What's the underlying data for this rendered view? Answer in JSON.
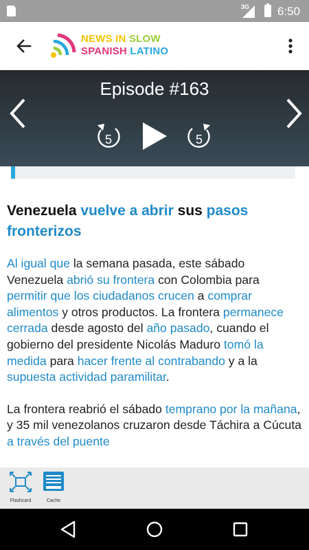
{
  "status_bar": {
    "network": "3G",
    "time": "6:50",
    "icons": [
      "sd-card-icon",
      "signal-icon",
      "battery-icon"
    ]
  },
  "app_bar": {
    "brand_line1_a": "NEWS IN",
    "brand_line1_b": "SLOW",
    "brand_line2_a": "SPANISH",
    "brand_line2_b": "LATINO",
    "icons": [
      "back-arrow-icon",
      "logo-icon",
      "overflow-menu-icon"
    ]
  },
  "player": {
    "episode_title": "Episode #163",
    "rewind_seconds": "5",
    "forward_seconds": "5",
    "progress_fraction": 0.015
  },
  "article": {
    "headline": [
      {
        "t": "Venezuela ",
        "k": false
      },
      {
        "t": "vuelve a abrir",
        "k": true
      },
      {
        "t": " sus ",
        "k": false
      },
      {
        "t": "pasos fronterizos",
        "k": true
      }
    ],
    "paragraphs": [
      [
        {
          "t": "Al igual que",
          "k": true
        },
        {
          "t": " la semana pasada, este sábado Venezuela ",
          "k": false
        },
        {
          "t": "abrió su frontera",
          "k": true
        },
        {
          "t": " con Colombia para ",
          "k": false
        },
        {
          "t": "permitir que los ciudadanos crucen",
          "k": true
        },
        {
          "t": " a ",
          "k": false
        },
        {
          "t": "comprar alimentos",
          "k": true
        },
        {
          "t": " y otros productos. La frontera ",
          "k": false
        },
        {
          "t": "permanece cerrada",
          "k": true
        },
        {
          "t": " desde agosto del ",
          "k": false
        },
        {
          "t": "año pasado",
          "k": true
        },
        {
          "t": ", cuando el gobierno del presidente Nicolás Maduro ",
          "k": false
        },
        {
          "t": "tomó la medida",
          "k": true
        },
        {
          "t": " para ",
          "k": false
        },
        {
          "t": "hacer frente al contrabando",
          "k": true
        },
        {
          "t": " y a la ",
          "k": false
        },
        {
          "t": "supuesta actividad paramilitar",
          "k": true
        },
        {
          "t": ".",
          "k": false
        }
      ],
      [
        {
          "t": "La frontera reabrió el sábado ",
          "k": false
        },
        {
          "t": "temprano por la mañana",
          "k": true
        },
        {
          "t": ", y 35 mil venezolanos cruzaron desde Táchira a Cúcuta ",
          "k": false
        },
        {
          "t": "a través del puente",
          "k": true
        }
      ]
    ]
  },
  "toolbar": {
    "flashcard_label": "Flashcard",
    "cache_label": "Cache"
  },
  "nav_bar": {
    "icons": [
      "nav-back-icon",
      "nav-home-icon",
      "nav-recents-icon"
    ]
  },
  "colors": {
    "keyword": "#1f8ac9",
    "accent": "#29a8de",
    "player_bg": "#2f3a42"
  }
}
